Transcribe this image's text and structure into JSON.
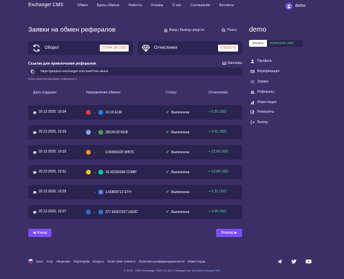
{
  "header": {
    "brand": "Exchanger CMS",
    "nav": [
      "Обмен",
      "Курсы обмена",
      "Новости",
      "Отзывы",
      "О нас",
      "Соглашение",
      "Контакты"
    ],
    "user": "demo"
  },
  "main": {
    "title": "Заявки на обмен рефералов",
    "io_button": "Ввод / Вывод средств",
    "search_button": "Поиск",
    "turnover_label": "Оборот",
    "turnover_value": "27544.38 USD",
    "deductions_label": "Отчисления",
    "deductions_value": "0.5000 %",
    "ref_label": "Ссылка для привлечения рефералов",
    "banners_button": "Баннеры",
    "ref_link": "https://product-exchanger-cms.test/?ref=demo",
    "ref_note": "Всего зарегистрировано рефералов 3"
  },
  "table": {
    "headers": [
      "Дата создания",
      "Направление обмена",
      "Статус",
      "Отчисления"
    ],
    "rows": [
      {
        "date": "20.12.2020, 10:34",
        "amount": "10.19 EUR",
        "status": "Выполнена",
        "fee": "+ 0.05 USD",
        "c1": "#e53935",
        "c2": "#1e88e5"
      },
      {
        "date": "20.12.2020, 10:33",
        "amount": "28224.00 RUB",
        "status": "Выполнена",
        "fee": "+ 2.01 USD",
        "c1": "#7fb0e8",
        "c2": "#43a047"
      },
      {
        "date": "20.12.2020, 10:32",
        "amount": "0.99950025 WBTC",
        "status": "Выполнена",
        "fee": "+ 22.66 USD",
        "c1": "#f7931a",
        "c2": "#2b2b2b"
      },
      {
        "date": "20.12.2020, 10:31",
        "amount": "18.42299189 COMP",
        "status": "Выполнена",
        "fee": "+ 12.00 USD",
        "c1": "#f5c518",
        "c2": "#00d395"
      },
      {
        "date": "20.12.2020, 10:29",
        "amount": "1.60809712 ETH",
        "status": "Выполнена",
        "fee": "+ 5.31 USD",
        "c1": "#2b2b2b",
        "c2": "#627eea"
      },
      {
        "date": "20.12.2020, 10:27",
        "amount": "377.66307227 USDC",
        "status": "Выполнена",
        "fee": "+ 2.00 USD",
        "c1": "#2b6fd6",
        "c2": "#2775ca"
      }
    ]
  },
  "pager": {
    "prev": "Назад",
    "next": "Вперед"
  },
  "sidebar": {
    "title": "demo",
    "balance_label": "Баланс",
    "balance_value": "923613.00 USD",
    "items": [
      "Профиль",
      "Верификация",
      "Заявки",
      "Рефералы",
      "Инвестиции",
      "Реквизиты",
      "Выход"
    ]
  },
  "footer": {
    "links": [
      "Блог",
      "FAQ",
      "Лицензии",
      "Партнерам",
      "Бонусы",
      "Злой совет клиента",
      "Политика конфиденциальности",
      "Инвестиции"
    ],
    "copyright": "© 2019 - 2020 Exchanger CMS v.1.16.0 | Telegram чат ",
    "copyright_link": "@HelloExchangerCMS"
  },
  "colors": {
    "bg": "#3b2f66",
    "panel": "#2a2350",
    "accent": "#7c4cf5",
    "success": "#5ee08a"
  }
}
